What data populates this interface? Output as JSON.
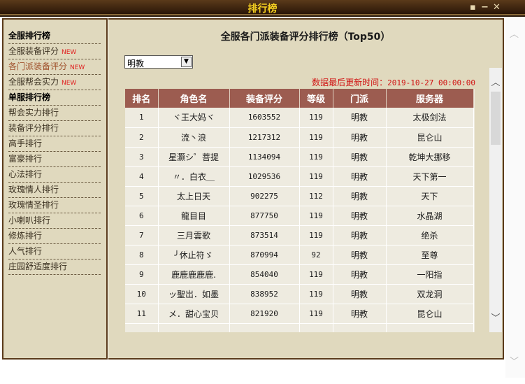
{
  "window": {
    "title": "排行榜",
    "pin": "▪",
    "minimize": "−",
    "close": "✕"
  },
  "sidebar": {
    "items": [
      {
        "label": "全服排行榜",
        "type": "header"
      },
      {
        "label": "全服装备评分",
        "new": "NEW"
      },
      {
        "label": "各门派装备评分",
        "new": "NEW",
        "active": true
      },
      {
        "label": "全服帮会实力",
        "new": "NEW"
      },
      {
        "label": "单服排行榜",
        "type": "header"
      },
      {
        "label": "帮会实力排行"
      },
      {
        "label": "装备评分排行"
      },
      {
        "label": "高手排行"
      },
      {
        "label": "富豪排行"
      },
      {
        "label": "心法排行"
      },
      {
        "label": "玫瑰情人排行"
      },
      {
        "label": "玫瑰情圣排行"
      },
      {
        "label": "小喇叭排行"
      },
      {
        "label": "修炼排行"
      },
      {
        "label": "人气排行"
      },
      {
        "label": "庄园舒适度排行"
      }
    ]
  },
  "main": {
    "title": "全服各门派装备评分排行榜（Top50）",
    "sect_select": "明教",
    "update_label": "数据最后更新时间：",
    "update_time": "2019-10-27 00:00:00",
    "columns": [
      "排名",
      "角色名",
      "装备评分",
      "等级",
      "门派",
      "服务器"
    ],
    "rows": [
      [
        "1",
        "ヾ王大妈ヾ",
        "1603552",
        "119",
        "明教",
        "太极剑法"
      ],
      [
        "2",
        "流丶浪",
        "1217312",
        "119",
        "明教",
        "昆仑山"
      ],
      [
        "3",
        "星灏シ゜菩提",
        "1134094",
        "119",
        "明教",
        "乾坤大挪移"
      ],
      [
        "4",
        "〃．白衣＿",
        "1029536",
        "119",
        "明教",
        "天下第一"
      ],
      [
        "5",
        "太上日天",
        "902275",
        "112",
        "明教",
        "天下"
      ],
      [
        "6",
        "龍目目",
        "877750",
        "119",
        "明教",
        "水晶湖"
      ],
      [
        "7",
        "三月雲歌",
        "873514",
        "119",
        "明教",
        "绝杀"
      ],
      [
        "8",
        "╯休止符ゞ",
        "870994",
        "92",
        "明教",
        "至尊"
      ],
      [
        "9",
        "鹿鹿鹿鹿鹿.",
        "854040",
        "119",
        "明教",
        "一阳指"
      ],
      [
        "10",
        "ッ聖岀．如墨",
        "838952",
        "119",
        "明教",
        "双龙洞"
      ],
      [
        "11",
        "メ．甜心宝贝",
        "821920",
        "119",
        "明教",
        "昆仑山"
      ]
    ]
  },
  "colors": {
    "header": "#9c5c50",
    "accent": "#d01010",
    "title": "#f5d020"
  }
}
